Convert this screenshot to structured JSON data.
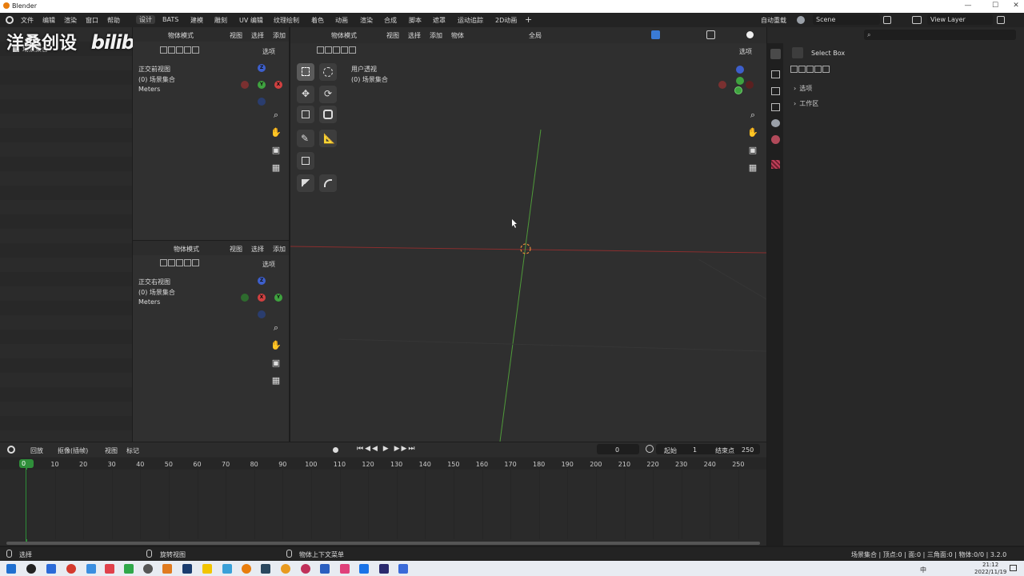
{
  "window": {
    "title": "Blender",
    "min": "—",
    "max": "☐",
    "close": "✕"
  },
  "menu": {
    "items": [
      "文件",
      "编辑",
      "渲染",
      "窗口",
      "帮助"
    ],
    "workspaces": [
      "设计",
      "BATS",
      "建模",
      "雕刻",
      "UV 编辑",
      "纹理绘制",
      "着色",
      "动画",
      "渲染",
      "合成",
      "脚本",
      "遮罩",
      "运动追踪",
      "2D动画"
    ],
    "add_ws": "+",
    "autosave": "自动重载",
    "scene": "Scene",
    "view_layer": "View Layer"
  },
  "watermark": {
    "text": "洋桑创设",
    "logo": "bilibili"
  },
  "outliner": {
    "item": "场景集合"
  },
  "front_view": {
    "mode": "物体模式",
    "menus": [
      "视图",
      "选择",
      "添加"
    ],
    "options": "选项",
    "title": "正交前视图",
    "collection": "(0) 场景集合",
    "units": "Meters"
  },
  "right_view": {
    "mode": "物体模式",
    "menus": [
      "视图",
      "选择",
      "添加"
    ],
    "options": "选项",
    "title": "正交右视图",
    "collection": "(0) 场景集合",
    "units": "Meters"
  },
  "main_view": {
    "mode": "物体模式",
    "menus": [
      "视图",
      "选择",
      "添加",
      "物体"
    ],
    "global": "全局",
    "options": "选项",
    "title": "用户透视",
    "collection": "(0) 场景集合"
  },
  "properties": {
    "tool": "Select Box",
    "sections": [
      "选项",
      "工作区"
    ]
  },
  "timeline": {
    "menus": [
      "回放",
      "抠像(插帧)",
      "视图",
      "标记"
    ],
    "current": "0",
    "start_label": "起始",
    "start": "1",
    "end_label": "结束点",
    "end": "250",
    "ticks": [
      "0",
      "10",
      "20",
      "30",
      "40",
      "50",
      "60",
      "70",
      "80",
      "90",
      "100",
      "110",
      "120",
      "130",
      "140",
      "150",
      "160",
      "170",
      "180",
      "190",
      "200",
      "210",
      "220",
      "230",
      "240",
      "250"
    ]
  },
  "status": {
    "left": "选择",
    "middle": "旋转视图",
    "right": "物体上下文菜单",
    "stats": "场景集合 | 顶点:0 | 面:0 | 三角面:0 | 物体:0/0 | 3.2.0"
  },
  "taskbar": {
    "time": "21:12",
    "date": "2022/11/19",
    "lang": "中"
  },
  "colors": {
    "x_axis": "#d24040",
    "y_axis": "#3fa33f",
    "z_axis": "#3d5fcc",
    "accent": "#3a7bd5",
    "current_frame": "#2f8f3a"
  }
}
